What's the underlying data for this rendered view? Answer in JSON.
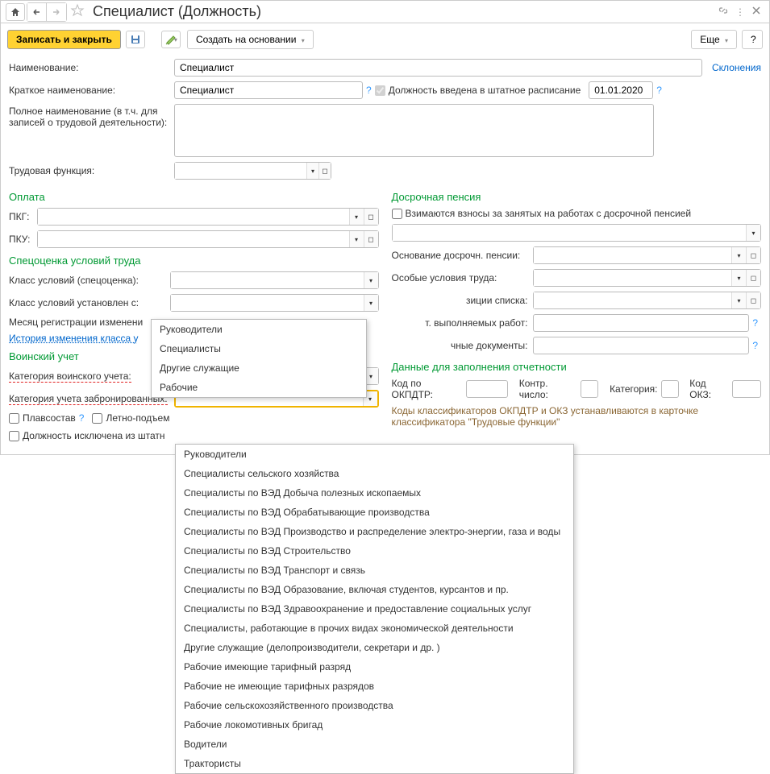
{
  "titlebar": {
    "title": "Специалист (Должность)"
  },
  "toolbar": {
    "save_close": "Записать и закрыть",
    "create_based": "Создать на основании",
    "more": "Еще",
    "help": "?"
  },
  "labels": {
    "name": "Наименование:",
    "short_name": "Краткое наименование:",
    "full_name": "Полное наименование (в т.ч. для записей о трудовой деятельности):",
    "labor_function": "Трудовая функция:",
    "staff_schedule": "Должность введена в штатное расписание",
    "declensions": "Склонения",
    "payment_header": "Оплата",
    "pkg": "ПКГ:",
    "pku": "ПКУ:",
    "spec_header": "Спецоценка условий труда",
    "class_spec": "Класс условий (спецоценка):",
    "class_set": "Класс условий установлен с:",
    "month_reg": "Месяц регистрации изменени",
    "history": "История изменения класса у",
    "mil_header": "Воинский учет",
    "mil_category": "Категория воинского учета:",
    "booked_category": "Категория учета забронированных:",
    "float": "Плавсостав",
    "flight": "Летно-подъем",
    "excluded": "Должность исключена из штатн",
    "early_pension_header": "Досрочная пенсия",
    "contributions": "Взимаются взносы за занятых на работах с досрочной пенсией",
    "basis": "Основание досрочн. пенсии:",
    "special_cond": "Особые условия труда:",
    "list_pos": "зиции списка:",
    "work_types": "т. выполняемых работ:",
    "docs": "чные документы:",
    "report_header": "Данные для заполнения отчетности",
    "okpdtr": "Код по ОКПДТР:",
    "check_num": "Контр. число:",
    "category": "Категория:",
    "okz": "Код ОКЗ:",
    "note": "Коды классификаторов ОКПДТР и ОКЗ устанавливаются в карточке классификатора \"Трудовые функции\""
  },
  "values": {
    "name": "Специалист",
    "short_name": "Специалист",
    "date": "01.01.2020"
  },
  "dropdown1": {
    "items": [
      "Руководители",
      "Специалисты",
      "Другие служащие",
      "Рабочие"
    ]
  },
  "dropdown2": {
    "items": [
      "Руководители",
      "Специалисты сельского хозяйства",
      "Специалисты по ВЭД Добыча полезных ископаемых",
      "Специалисты по ВЭД Обрабатывающие производства",
      "Специалисты по ВЭД Производство и распределение электро-энергии, газа и воды",
      "Специалисты по ВЭД Строительство",
      "Специалисты по ВЭД Транспорт и связь",
      "Специалисты по ВЭД Образование, включая студентов, курсантов и пр.",
      "Специалисты по ВЭД Здравоохранение и предоставление социальных услуг",
      "Специалисты, работающие в прочих видах экономической деятельности",
      "Другие служащие (делопроизводители, секретари и др. )",
      "Рабочие имеющие тарифный разряд",
      "Рабочие не имеющие тарифных разрядов",
      "Рабочие сельскохозяйственного производства",
      "Рабочие локомотивных бригад",
      "Водители",
      "Трактористы"
    ]
  }
}
